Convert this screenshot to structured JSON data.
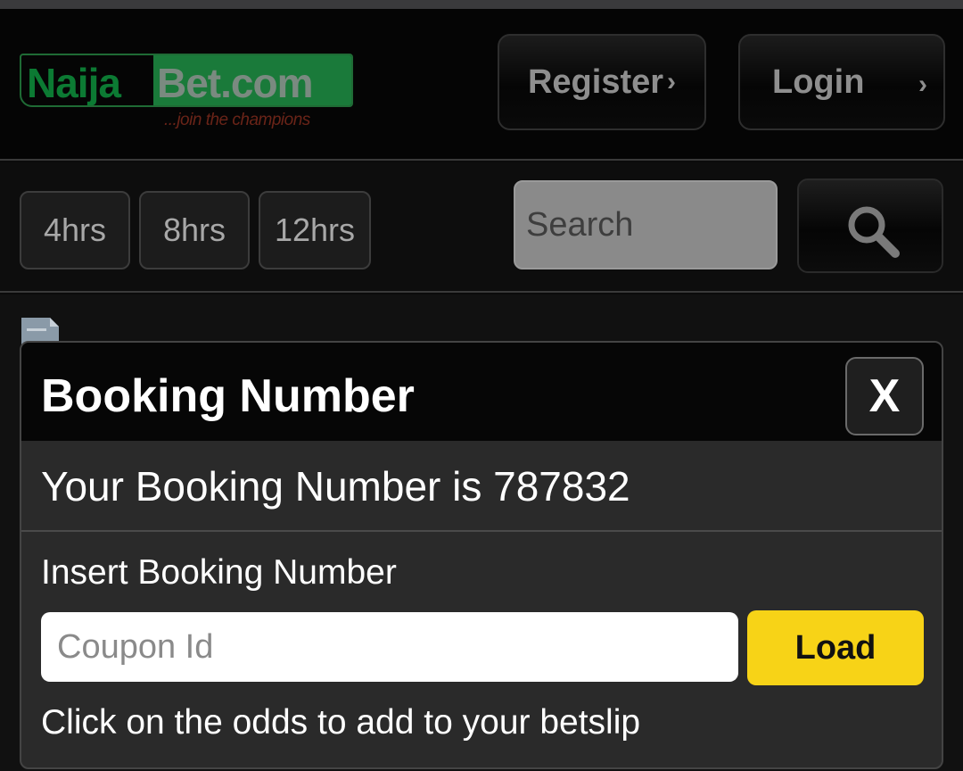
{
  "header": {
    "logo": {
      "part1": "Naija",
      "part2": "Bet.com",
      "tagline": "...join the champions"
    },
    "register_label": "Register",
    "login_label": "Login",
    "chevron": "›"
  },
  "filters": {
    "chips": [
      "4hrs",
      "8hrs",
      "12hrs"
    ],
    "search_placeholder": "Search"
  },
  "modal": {
    "title": "Booking Number",
    "close_label": "X",
    "message": "Your Booking Number is 787832",
    "insert_label": "Insert Booking Number",
    "coupon_placeholder": "Coupon Id",
    "load_label": "Load",
    "hint": "Click on the odds to add to your betslip"
  },
  "colors": {
    "accent_yellow": "#f7d317",
    "brand_green": "#1a7a3a",
    "background": "#0b0b0b"
  },
  "icons": [
    "search-icon",
    "document-icon"
  ]
}
